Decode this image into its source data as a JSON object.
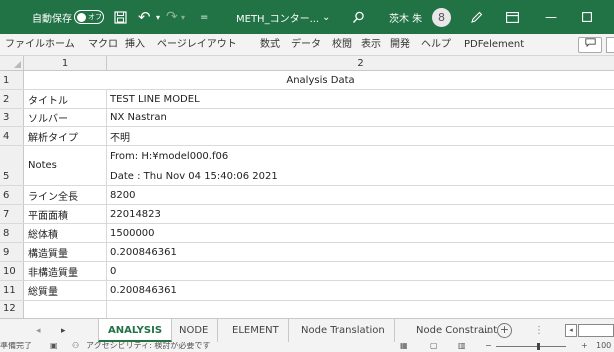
{
  "titlebar": {
    "autosave_label": "自動保存",
    "autosave_state": "オフ",
    "doc_title": "METH_コンター...",
    "user_name": "茨木 朱",
    "avatar_glyph": "8",
    "icons": [
      "save-icon",
      "undo-icon",
      "redo-icon",
      "search-icon",
      "pen-icon",
      "ribbon-display-icon",
      "minimize-icon",
      "maximize-icon"
    ]
  },
  "menu": {
    "items": [
      "ファイル",
      "ホーム",
      "マクロ",
      "挿入",
      "ページレイアウト",
      "数式",
      "データ",
      "校閲",
      "表示",
      "開発",
      "ヘルプ",
      "PDFelement"
    ]
  },
  "columns": {
    "corner": "",
    "col1": "1",
    "col2": "2"
  },
  "rows": [
    {
      "num": "1",
      "a": "",
      "b": "Analysis Data"
    },
    {
      "num": "2",
      "a": "タイトル",
      "b": "TEST LINE MODEL"
    },
    {
      "num": "3",
      "a": "ソルバー",
      "b": "NX Nastran"
    },
    {
      "num": "4",
      "a": "解析タイプ",
      "b": "不明"
    },
    {
      "num": "5",
      "a": "Notes",
      "b": "From: H:¥model000.f06",
      "b2": "Date : Thu Nov 04 15:40:06 2021"
    },
    {
      "num": "6",
      "a": "ライン全長",
      "b": "8200"
    },
    {
      "num": "7",
      "a": "平面面積",
      "b": "22014823"
    },
    {
      "num": "8",
      "a": "総体積",
      "b": "1500000"
    },
    {
      "num": "9",
      "a": "構造質量",
      "b": "0.200846361"
    },
    {
      "num": "10",
      "a": "非構造質量",
      "b": "0"
    },
    {
      "num": "11",
      "a": "総質量",
      "b": "0.200846361"
    },
    {
      "num": "12",
      "a": "",
      "b": ""
    }
  ],
  "sheet_tabs": {
    "items": [
      "ANALYSIS",
      "NODE",
      "ELEMENT",
      "Node Translation",
      "Node Constraint"
    ],
    "active": "ANALYSIS",
    "more": "...",
    "add": "+"
  },
  "statusbar": {
    "ready": "準備完了",
    "accessibility": "アクセシビリティ: 検討が必要です",
    "zoom_minus": "−",
    "zoom_plus": "+",
    "zoom_level": "100"
  },
  "accent_color": "#217346"
}
